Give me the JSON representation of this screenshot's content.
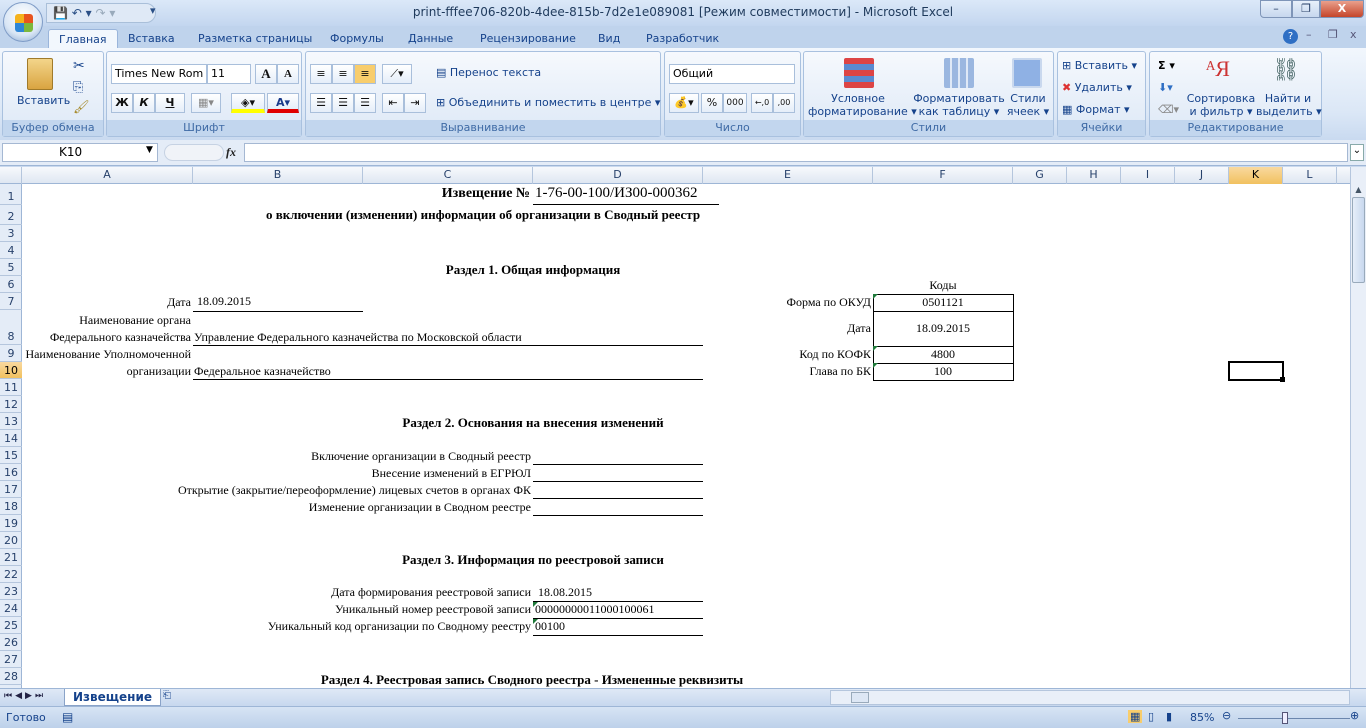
{
  "window": {
    "title": "print-fffee706-820b-4dee-815b-7d2e1e089081  [Режим совместимости] - Microsoft Excel",
    "minimize": "–",
    "restore": "❐",
    "close": "X"
  },
  "qat": {
    "save": "💾",
    "undo": "↶ ▾",
    "redo": "↷ ▾",
    "customize": "▾"
  },
  "tabs": [
    "Главная",
    "Вставка",
    "Разметка страницы",
    "Формулы",
    "Данные",
    "Рецензирование",
    "Вид",
    "Разработчик"
  ],
  "ribbon": {
    "clipboard": {
      "label": "Буфер обмена",
      "paste": "Вставить"
    },
    "font": {
      "label": "Шрифт",
      "font_name": "Times New Rom",
      "font_size": "11",
      "bold": "Ж",
      "italic": "К",
      "underline": "Ч",
      "grow": "A",
      "shrink": "A"
    },
    "alignment": {
      "label": "Выравнивание",
      "wrap": "Перенос текста",
      "merge": "Объединить и поместить в центре"
    },
    "number": {
      "label": "Число",
      "format": "Общий",
      "percent": "%",
      "thousands": "000",
      "inc": "←,0",
      "dec": ",00"
    },
    "styles": {
      "label": "Стили",
      "conditional": [
        "Условное",
        "форматирование ▾"
      ],
      "as_table": [
        "Форматировать",
        "как таблицу ▾"
      ],
      "cell_styles": [
        "Стили",
        "ячеек ▾"
      ]
    },
    "cells": {
      "label": "Ячейки",
      "insert": "Вставить ▾",
      "delete": "Удалить ▾",
      "format": "Формат ▾"
    },
    "editing": {
      "label": "Редактирование",
      "sum": "Σ ▾",
      "sort": [
        "Сортировка",
        "и фильтр ▾"
      ],
      "find": [
        "Найти и",
        "выделить ▾"
      ]
    }
  },
  "formula_bar": {
    "name_box": "K10",
    "fx": "fx",
    "formula": ""
  },
  "columns": [
    "A",
    "B",
    "C",
    "D",
    "E",
    "F",
    "G",
    "H",
    "I",
    "J",
    "K",
    "L"
  ],
  "selected_cell": "K10",
  "rows": [
    "1",
    "2",
    "3",
    "4",
    "5",
    "6",
    "7",
    "8",
    "9",
    "10",
    "11",
    "12",
    "13",
    "14",
    "15",
    "16",
    "17",
    "18",
    "19",
    "20",
    "21",
    "22",
    "23",
    "24",
    "25",
    "26",
    "27",
    "28"
  ],
  "doc": {
    "title_prefix": "Извещение №",
    "title_number": "1-76-00-100/ИЗ00-000362",
    "subtitle": "о включении (изменении) информации об организации в Сводный реестр",
    "section1": "Раздел 1. Общая информация",
    "date_label": "Дата",
    "date_value": "18.09.2015",
    "org_label_1": "Наименование органа",
    "org_label_2": "Федерального казначейства",
    "org_value": "Управление Федерального казначейства по Московской области",
    "auth_label_1": "Наименование Уполномоченной",
    "auth_label_2": "организации",
    "auth_value": "Федеральное казначейство",
    "codes": {
      "header": "Коды",
      "rows": [
        {
          "label": "Форма по ОКУД",
          "value": "0501121"
        },
        {
          "label": "Дата",
          "value": "18.09.2015"
        },
        {
          "label": "Код по КОФК",
          "value": "4800"
        },
        {
          "label": "Глава по БК",
          "value": "100"
        }
      ]
    },
    "section2": "Раздел 2. Основания на внесения изменений",
    "section2_items": [
      "Включение организации в Сводный реестр",
      "Внесение изменений в ЕГРЮЛ",
      "Открытие (закрытие/переоформление) лицевых счетов в органах ФК",
      "Изменение организации в Сводном реестре"
    ],
    "section3": "Раздел 3. Информация по реестровой записи",
    "section3_items": [
      {
        "label": "Дата формирования реестровой записи",
        "value": "18.08.2015"
      },
      {
        "label": "Уникальный номер реестровой записи",
        "value": "00000000011000100061"
      },
      {
        "label": "Уникальный код организации по Сводному реестру",
        "value": "00100"
      }
    ],
    "section4": "Раздел 4. Реестровая запись Сводного реестра - Измененные реквизиты"
  },
  "sheet_tabs": [
    "Извещение"
  ],
  "status": {
    "ready": "Готово",
    "zoom": "85%",
    "zoom_level": 85
  }
}
